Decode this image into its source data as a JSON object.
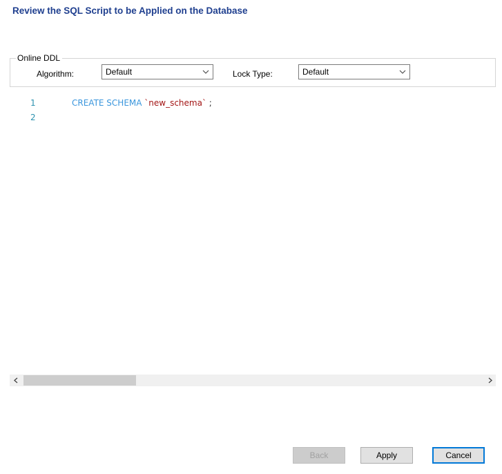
{
  "dialog": {
    "title": "Review the SQL Script to be Applied on the Database"
  },
  "online_ddl": {
    "legend": "Online DDL",
    "algorithm_label": "Algorithm:",
    "algorithm_value": "Default",
    "lock_type_label": "Lock Type:",
    "lock_type_value": "Default"
  },
  "editor": {
    "lines": [
      {
        "number": "1",
        "keyword": "CREATE SCHEMA ",
        "string": "`new_schema`",
        "punct": " ;"
      },
      {
        "number": "2",
        "keyword": "",
        "string": "",
        "punct": ""
      }
    ]
  },
  "buttons": {
    "back": "Back",
    "apply": "Apply",
    "cancel": "Cancel"
  },
  "icons": {
    "dropdown": "chevron-down-icon",
    "scroll_left": "chevron-left-icon",
    "scroll_right": "chevron-right-icon"
  }
}
